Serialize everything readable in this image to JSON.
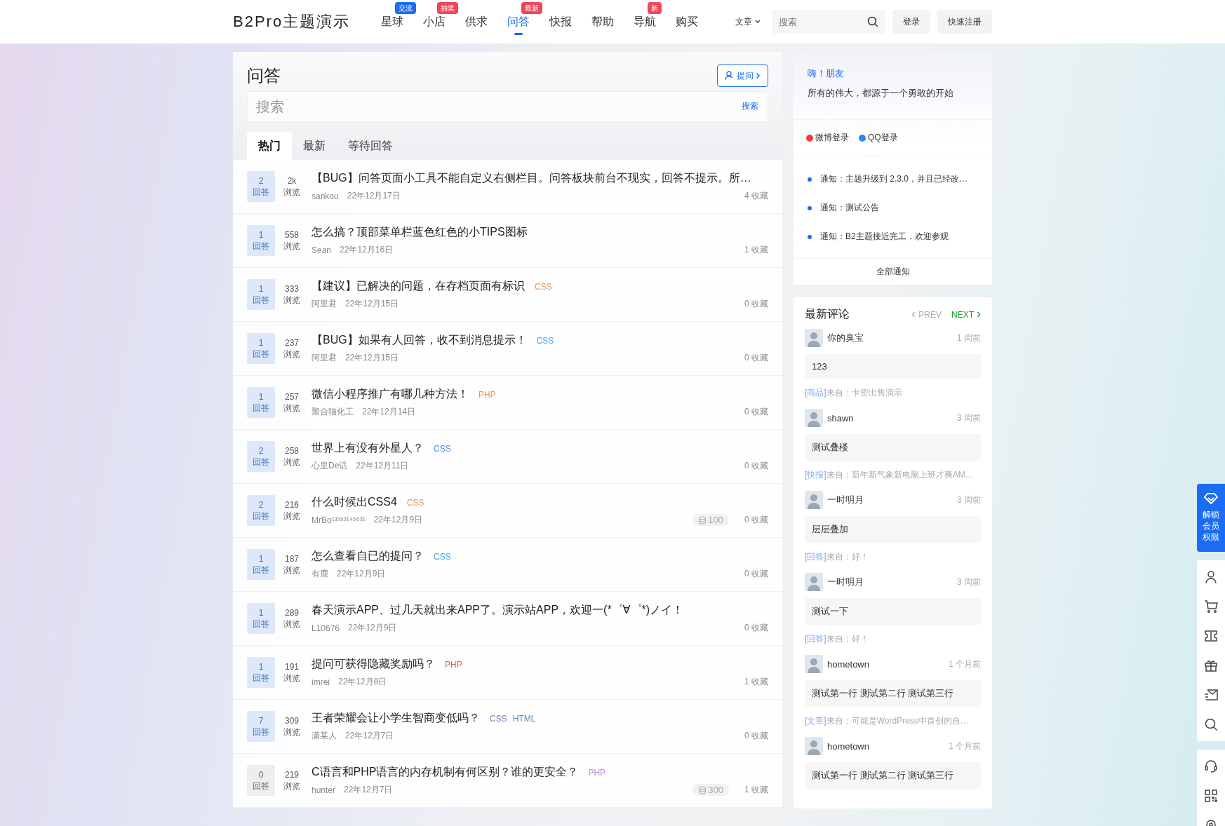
{
  "header": {
    "logo": "B2Pro主题演示",
    "nav": [
      {
        "label": "星球",
        "badge": {
          "label": "交流",
          "color": "#1a6cf5"
        },
        "selected": false
      },
      {
        "label": "小店",
        "badge": {
          "label": "抽奖",
          "color": "#f0465a"
        },
        "selected": false
      },
      {
        "label": "供求",
        "selected": false
      },
      {
        "label": "问答",
        "badge": {
          "label": "最新",
          "color": "#f0465a"
        },
        "selected": true
      },
      {
        "label": "快报",
        "selected": false
      },
      {
        "label": "帮助",
        "selected": false
      },
      {
        "label": "导航",
        "badge": {
          "label": "新",
          "color": "#f0465a"
        },
        "selected": false
      },
      {
        "label": "购买",
        "selected": false
      }
    ],
    "search_scope": "文章",
    "search": {
      "placeholder": "搜索"
    },
    "buttons": [
      "登录",
      "快速注册"
    ]
  },
  "main": {
    "title": "问答",
    "ask_button": "提问",
    "search": {
      "placeholder": "搜索",
      "button": "搜索"
    },
    "tabs": [
      {
        "label": "热门",
        "selected": true
      },
      {
        "label": "最新",
        "selected": false
      },
      {
        "label": "等待回答",
        "selected": false
      }
    ],
    "questions": [
      {
        "answers": "2",
        "answers_label": "回答",
        "answered": true,
        "views": "2k",
        "views_label": "浏览",
        "title": "【BUG】问答页面小工具不能自定义右侧栏目。问答板块前台不现实，回答不提示。所…",
        "author": "sankou",
        "date": "22年12月17日",
        "favorites": "4 收藏"
      },
      {
        "answers": "1",
        "answers_label": "回答",
        "answered": true,
        "views": "558",
        "views_label": "浏览",
        "title": "怎么搞？顶部菜单栏蓝色红色的小TIPS图标",
        "author": "Sean",
        "date": "22年12月16日",
        "favorites": "1 收藏"
      },
      {
        "answers": "1",
        "answers_label": "回答",
        "answered": true,
        "views": "333",
        "views_label": "浏览",
        "title": "【建议】已解决的问题，在存档页面有标识",
        "tags": [
          {
            "label": "CSS",
            "color": "#e8964a"
          }
        ],
        "author": "阿里君",
        "date": "22年12月15日",
        "favorites": "0 收藏"
      },
      {
        "answers": "1",
        "answers_label": "回答",
        "answered": true,
        "views": "237",
        "views_label": "浏览",
        "title": "【BUG】如果有人回答，收不到消息提示！",
        "tags": [
          {
            "label": "CSS",
            "color": "#4aa3d8"
          }
        ],
        "author": "阿里君",
        "date": "22年12月15日",
        "favorites": "0 收藏"
      },
      {
        "answers": "1",
        "answers_label": "回答",
        "answered": true,
        "views": "257",
        "views_label": "浏览",
        "title": "微信小程序推广有哪几种方法！",
        "tags": [
          {
            "label": "PHP",
            "color": "#e8964a"
          }
        ],
        "author": "聚合猫化工",
        "date": "22年12月14日",
        "favorites": "0 收藏"
      },
      {
        "answers": "2",
        "answers_label": "回答",
        "answered": true,
        "views": "258",
        "views_label": "浏览",
        "title": "世界上有没有外星人？",
        "tags": [
          {
            "label": "CSS",
            "color": "#4a90e2"
          }
        ],
        "author": "心里De话",
        "date": "22年12月11日",
        "favorites": "0 收藏"
      },
      {
        "answers": "2",
        "answers_label": "回答",
        "answered": true,
        "views": "216",
        "views_label": "浏览",
        "title": "什么时候出CSS4",
        "tags": [
          {
            "label": "CSS",
            "color": "#e8964a"
          }
        ],
        "author": "MrBo¹³³⁵³¹⁴⁵⁶³¹",
        "date": "22年12月9日",
        "reward": "100",
        "favorites": "0 收藏"
      },
      {
        "answers": "1",
        "answers_label": "回答",
        "answered": true,
        "views": "187",
        "views_label": "浏览",
        "title": "怎么查看自已的提问？",
        "tags": [
          {
            "label": "CSS",
            "color": "#4aa3d8"
          }
        ],
        "author": "有鹿",
        "date": "22年12月9日",
        "favorites": "0 收藏"
      },
      {
        "answers": "1",
        "answers_label": "回答",
        "answered": true,
        "views": "289",
        "views_label": "浏览",
        "title": "春天演示APP、过几天就出来APP了。演示站APP，欢迎一(*゜∀゜*)ノイ！",
        "author": "L10676",
        "date": "22年12月9日",
        "favorites": "0 收藏"
      },
      {
        "answers": "1",
        "answers_label": "回答",
        "answered": true,
        "views": "191",
        "views_label": "浏览",
        "title": "提问可获得隐藏奖励吗？",
        "tags": [
          {
            "label": "PHP",
            "color": "#e05a5a"
          }
        ],
        "author": "imrei",
        "date": "22年12月8日",
        "favorites": "1 收藏"
      },
      {
        "answers": "7",
        "answers_label": "回答",
        "answered": true,
        "views": "309",
        "views_label": "浏览",
        "title": "王者荣耀会让小学生智商变低吗？",
        "tags": [
          {
            "label": "CSS",
            "color": "#7a7fc8"
          },
          {
            "label": "HTML",
            "color": "#5a8fb8"
          }
        ],
        "author": "潇某人",
        "date": "22年12月7日",
        "favorites": "0 收藏"
      },
      {
        "answers": "0",
        "answers_label": "回答",
        "answered": false,
        "views": "219",
        "views_label": "浏览",
        "title": "C语言和PHP语言的内存机制有何区别？谁的更安全？",
        "tags": [
          {
            "label": "PHP",
            "color": "#b88ad8"
          }
        ],
        "author": "hunter",
        "date": "22年12月7日",
        "reward": "300",
        "favorites": "1 收藏"
      }
    ]
  },
  "sidebar": {
    "greeting": "嗨！朋友",
    "motto": "所有的伟大，都源于一个勇敢的开始",
    "logins": [
      {
        "label": "微博登录",
        "color": "#f23d3d"
      },
      {
        "label": "QQ登录",
        "color": "#2f86f0"
      }
    ],
    "notices": [
      "通知：主题升级到 2.3.0，并且已经改…",
      "通知：测试公告",
      "通知：B2主题接近完工，欢迎参观"
    ],
    "all_notices": "全部通知",
    "comments_widget": {
      "title": "最新评论",
      "prev": {
        "label": "PREV",
        "disabled": true
      },
      "next": {
        "label": "NEXT",
        "disabled": false
      },
      "comments": [
        {
          "name": "你的臭宝",
          "time": "1 周前",
          "text": "123",
          "source_tag": "[商品]",
          "source": "来自：卡密出售演示"
        },
        {
          "name": "shawn",
          "time": "3 周前",
          "text": "测试叠楼",
          "source_tag": "[快报]",
          "source": "来自：新年新气象新电脑上班才爽AM…"
        },
        {
          "name": "一时明月",
          "time": "3 周前",
          "text": "层层叠加",
          "source_tag": "[回答]",
          "source": "来自：好！"
        },
        {
          "name": "一时明月",
          "time": "3 周前",
          "text": "测试一下",
          "source_tag": "[回答]",
          "source": "来自：好！"
        },
        {
          "name": "hometown",
          "time": "1 个月前",
          "text": "测试第一行 测试第二行 测试第三行",
          "source_tag": "[文章]",
          "source": "来自：可能是WordPress中首创的自…"
        },
        {
          "name": "hometown",
          "time": "1 个月前",
          "text": "测试第一行 测试第二行 测试第三行"
        }
      ]
    }
  },
  "float_bar": {
    "vip": "解锁会员权限"
  }
}
